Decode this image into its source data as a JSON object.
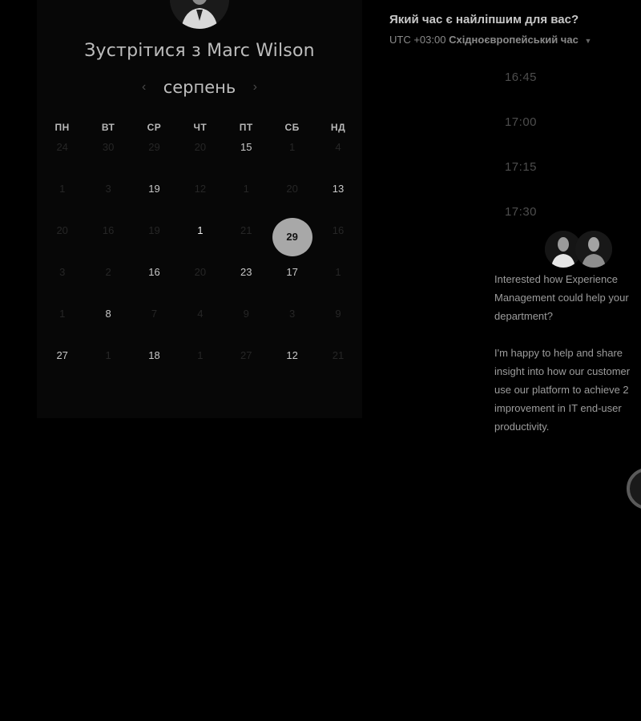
{
  "header": {
    "title": "Зустрітися з Marc Wilson"
  },
  "calendar": {
    "month": "серпень",
    "prev_icon": "chevron-left-icon",
    "next_icon": "chevron-right-icon",
    "weekdays": [
      "ПН",
      "ВТ",
      "СР",
      "ЧТ",
      "ПТ",
      "СБ",
      "НД"
    ],
    "days": [
      {
        "label": "24",
        "active": false
      },
      {
        "label": "30",
        "active": false
      },
      {
        "label": "29",
        "active": false
      },
      {
        "label": "20",
        "active": false
      },
      {
        "label": "15",
        "active": true
      },
      {
        "label": "1",
        "active": false
      },
      {
        "label": "4",
        "active": false
      },
      {
        "label": "1",
        "active": false
      },
      {
        "label": "3",
        "active": false
      },
      {
        "label": "19",
        "active": true
      },
      {
        "label": "12",
        "active": false
      },
      {
        "label": "1",
        "active": false
      },
      {
        "label": "20",
        "active": false
      },
      {
        "label": "13",
        "active": true
      },
      {
        "label": "20",
        "active": false
      },
      {
        "label": "16",
        "active": false
      },
      {
        "label": "19",
        "active": false
      },
      {
        "label": "1",
        "active": true,
        "bright": true
      },
      {
        "label": "21",
        "active": false
      },
      {
        "label": "29",
        "active": true,
        "selected": true
      },
      {
        "label": "16",
        "active": false
      },
      {
        "label": "3",
        "active": false
      },
      {
        "label": "2",
        "active": false
      },
      {
        "label": "16",
        "active": true
      },
      {
        "label": "20",
        "active": false
      },
      {
        "label": "23",
        "active": true
      },
      {
        "label": "17",
        "active": true
      },
      {
        "label": "1",
        "active": false
      },
      {
        "label": "1",
        "active": false
      },
      {
        "label": "8",
        "active": true
      },
      {
        "label": "7",
        "active": false
      },
      {
        "label": "4",
        "active": false
      },
      {
        "label": "9",
        "active": false
      },
      {
        "label": "3",
        "active": false
      },
      {
        "label": "9",
        "active": false
      },
      {
        "label": "27",
        "active": true
      },
      {
        "label": "1",
        "active": false
      },
      {
        "label": "18",
        "active": true
      },
      {
        "label": "1",
        "active": false
      },
      {
        "label": "27",
        "active": false
      },
      {
        "label": "12",
        "active": true
      },
      {
        "label": "21",
        "active": false
      }
    ]
  },
  "timepicker": {
    "question": "Який час є найліпшим для вас?",
    "timezone_offset": "UTC +03:00",
    "timezone_name": "Східноєвропейський час",
    "slots": [
      "16:45",
      "17:00",
      "17:15",
      "17:30"
    ]
  },
  "blurb": {
    "paragraph1": "Interested how Experience\nManagement could help your\ndepartment?",
    "paragraph2": "I'm happy to help and share\ninsight into how our customer\nuse our platform to achieve 2\nimprovement in IT end-user\nproductivity."
  },
  "colors": {
    "background": "#000000",
    "panel": "#070707",
    "selected_day": "#a8a8a8"
  }
}
